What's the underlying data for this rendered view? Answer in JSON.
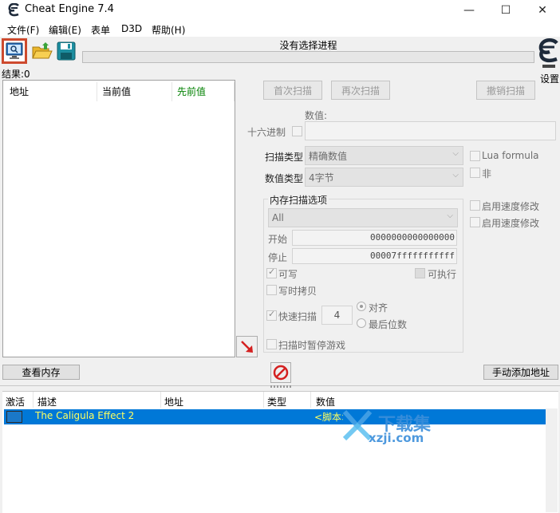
{
  "window": {
    "title": "Cheat Engine 7.4",
    "minimize": "—",
    "maximize": "☐",
    "close": "✕"
  },
  "menu": [
    "文件(F)",
    "编辑(E)",
    "表单",
    "D3D",
    "帮助(H)"
  ],
  "toolbar": {
    "process_label": "没有选择进程",
    "settings_label": "设置"
  },
  "results": {
    "label": "结果:0",
    "columns": [
      "地址",
      "当前值",
      "先前值"
    ],
    "prev_color": "#008000"
  },
  "scan": {
    "first_scan": "首次扫描",
    "next_scan": "再次扫描",
    "undo_scan": "撤销扫描",
    "value_label": "数值:",
    "hex_label": "十六进制",
    "scan_type_label": "扫描类型",
    "scan_type_value": "精确数值",
    "value_type_label": "数值类型",
    "value_type_value": "4字节",
    "lua_formula": "Lua formula",
    "not_label": "非",
    "speedhack_1": "启用速度修改",
    "speedhack_2": "启用速度修改"
  },
  "memory_options": {
    "title": "内存扫描选项",
    "region": "All",
    "start_label": "开始",
    "start_value": "0000000000000000",
    "stop_label": "停止",
    "stop_value": "00007fffffffffff",
    "writable": "可写",
    "executable": "可执行",
    "copy_on_write": "写时拷贝",
    "fast_scan": "快速扫描",
    "fast_scan_value": "4",
    "align": "对齐",
    "last_digits": "最后位数",
    "pause_game": "扫描时暂停游戏"
  },
  "actions": {
    "view_memory": "查看内存",
    "add_address": "手动添加地址"
  },
  "cheat_table": {
    "columns": [
      "激活",
      "描述",
      "地址",
      "类型",
      "数值"
    ],
    "rows": [
      {
        "description": "The Caligula Effect 2",
        "value": "<脚本>"
      }
    ]
  },
  "watermark": {
    "text_cn": "下载集",
    "text_url": "xzji.com"
  },
  "colors": {
    "accent_blue": "#0078d7",
    "toolbar_highlight": "#cd4a2e",
    "row_text": "#ffff60"
  }
}
